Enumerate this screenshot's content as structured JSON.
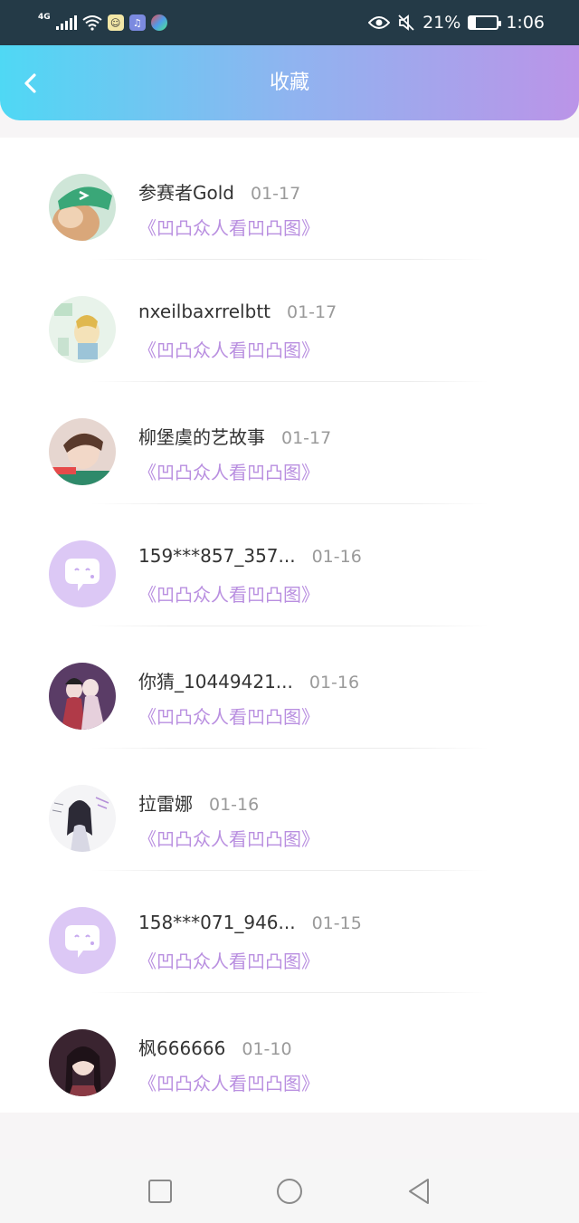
{
  "status_bar": {
    "network": "4G",
    "battery_percent": "21%",
    "battery_level": 0.21,
    "time": "1:06"
  },
  "header": {
    "title": "收藏",
    "gradient_start": "#4fd8f4",
    "gradient_end": "#bb94e8"
  },
  "list": {
    "title_color": "#b98fe0",
    "items": [
      {
        "username": "参赛者Gold",
        "date": "01-17",
        "work": "《凹凸众人看凹凸图》",
        "avatar": "anime-boy-green-cap"
      },
      {
        "username": "nxeilbaxrrelbtt",
        "date": "01-17",
        "work": "《凹凸众人看凹凸图》",
        "avatar": "anime-drawing"
      },
      {
        "username": "柳堡虞的艺故事",
        "date": "01-17",
        "work": "《凹凸众人看凹凸图》",
        "avatar": "boy-photo"
      },
      {
        "username": "159***857_357...",
        "date": "01-16",
        "work": "《凹凸众人看凹凸图》",
        "avatar": "default-chat-bubble"
      },
      {
        "username": "你猜_10449421...",
        "date": "01-16",
        "work": "《凹凸众人看凹凸图》",
        "avatar": "anime-couple"
      },
      {
        "username": "拉雷娜",
        "date": "01-16",
        "work": "《凹凸众人看凹凸图》",
        "avatar": "sketch-girl"
      },
      {
        "username": "158***071_946...",
        "date": "01-15",
        "work": "《凹凸众人看凹凸图》",
        "avatar": "default-chat-bubble"
      },
      {
        "username": "枫666666",
        "date": "01-10",
        "work": "《凹凸众人看凹凸图》",
        "avatar": "anime-girl-dark"
      }
    ]
  },
  "nav_bar": {
    "recents": "square-icon",
    "home": "circle-icon",
    "back": "triangle-back-icon"
  }
}
